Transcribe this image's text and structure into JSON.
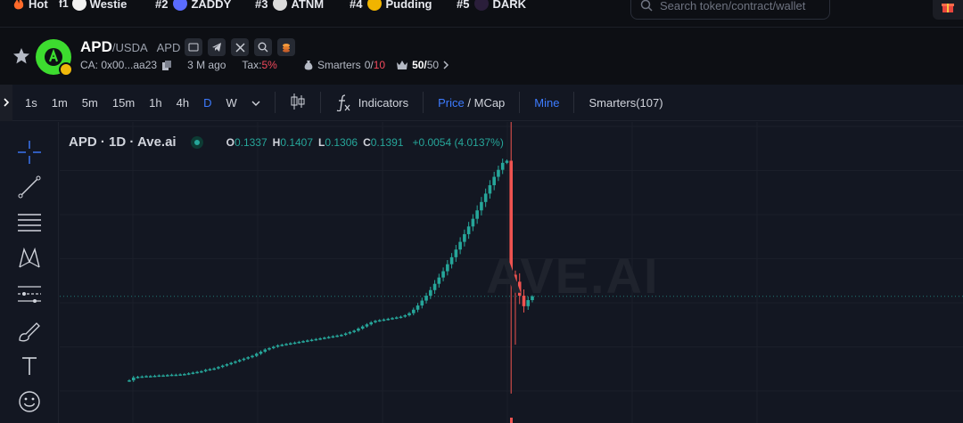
{
  "topbar": {
    "hot_label": "Hot",
    "items": [
      {
        "rank": "",
        "name": "Westie",
        "color": "#ffffff"
      },
      {
        "rank": "#2",
        "name": "ZADDY",
        "color": "#5a6cff"
      },
      {
        "rank": "#3",
        "name": "ATNM",
        "color": "#dcdcdc"
      },
      {
        "rank": "#4",
        "name": "Pudding",
        "color": "#f0b400"
      },
      {
        "rank": "#5",
        "name": "DARK",
        "color": "#2a1e3a"
      }
    ],
    "search_placeholder": "Search token/contract/wallet"
  },
  "token": {
    "symbol": "APD",
    "pair": "/USDA",
    "symbol2": "APD",
    "ca": "CA: 0x00...aa23",
    "age": "3 M ago",
    "tax_label": "Tax:",
    "tax_value": "5%",
    "smarters_label": "Smarters",
    "smarters_value": "0/",
    "smarters_value_red": "10",
    "holders_value": "50/",
    "holders_total": "50",
    "logo_color": "#3ddc2f"
  },
  "toolbar": {
    "intervals": [
      "1s",
      "1m",
      "5m",
      "15m",
      "1h",
      "4h",
      "D",
      "W"
    ],
    "active_interval": "D",
    "indicators_label": "Indicators",
    "price_label": "Price",
    "mcap_label": "MCap",
    "mine_label": "Mine",
    "smarters_label": "Smarters(107)"
  },
  "chart": {
    "title": "APD · 1D · Ave.ai",
    "open_label": "O",
    "open": "0.1337",
    "high_label": "H",
    "high": "0.1407",
    "low_label": "L",
    "low": "0.1306",
    "close_label": "C",
    "close": "0.1391",
    "change": "+0.0054 (4.0137%)",
    "watermark": "AVE.AI",
    "up_color": "#26a69a",
    "down_color": "#ef5350"
  },
  "chart_data": {
    "type": "candlestick",
    "interval": "1D",
    "title": "APD · 1D · Ave.ai",
    "last_candle": {
      "open": 0.1337,
      "high": 0.1407,
      "low": 0.1306,
      "close": 0.1391
    },
    "closes": [
      0.019,
      0.023,
      0.024,
      0.0245,
      0.025,
      0.025,
      0.0255,
      0.026,
      0.026,
      0.0265,
      0.027,
      0.027,
      0.0275,
      0.028,
      0.029,
      0.03,
      0.031,
      0.032,
      0.034,
      0.035,
      0.036,
      0.038,
      0.04,
      0.042,
      0.044,
      0.046,
      0.048,
      0.05,
      0.052,
      0.054,
      0.057,
      0.06,
      0.063,
      0.065,
      0.067,
      0.069,
      0.07,
      0.071,
      0.072,
      0.073,
      0.074,
      0.075,
      0.076,
      0.077,
      0.078,
      0.079,
      0.08,
      0.081,
      0.082,
      0.083,
      0.084,
      0.086,
      0.088,
      0.09,
      0.093,
      0.096,
      0.099,
      0.102,
      0.104,
      0.105,
      0.106,
      0.107,
      0.108,
      0.109,
      0.11,
      0.112,
      0.115,
      0.12,
      0.126,
      0.133,
      0.14,
      0.148,
      0.157,
      0.166,
      0.175,
      0.185,
      0.195,
      0.206,
      0.217,
      0.228,
      0.239,
      0.25,
      0.262,
      0.274,
      0.286,
      0.298,
      0.31,
      0.32,
      0.33,
      0.333,
      0.17,
      0.16,
      0.14,
      0.125,
      0.1337,
      0.1391
    ]
  }
}
